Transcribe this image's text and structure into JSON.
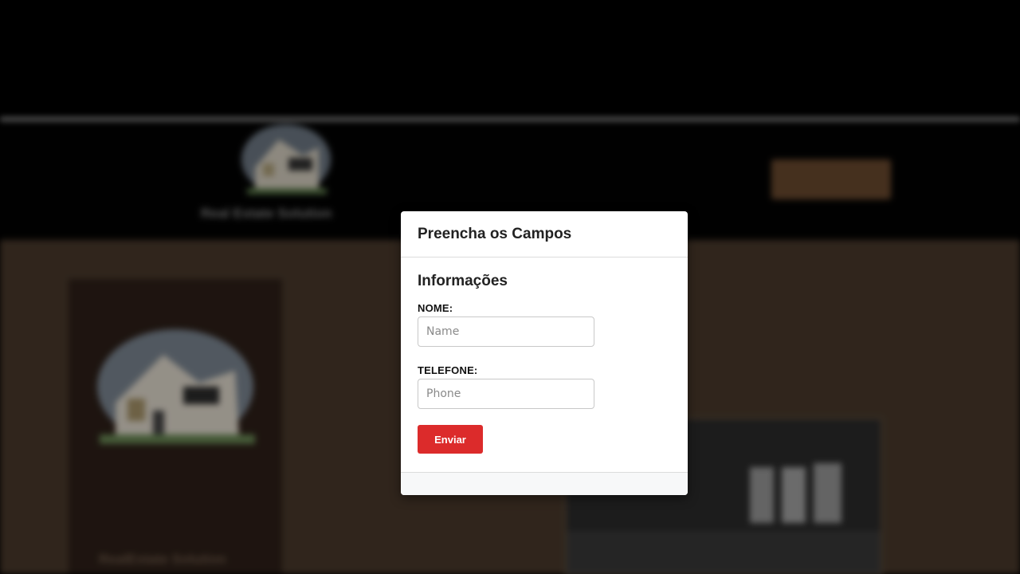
{
  "background": {
    "brand_text": "Real Estate Solution",
    "header_button_label": "",
    "card_text": "RealEstate Solution",
    "colors": {
      "header": "#030303",
      "content": "#4a3a2c",
      "card": "#2e2019",
      "accent_button": "#6b4a2f"
    }
  },
  "modal": {
    "title": "Preencha os Campos",
    "section_title": "Informações",
    "fields": [
      {
        "label": "NOME:",
        "placeholder": "Name",
        "value": ""
      },
      {
        "label": "TELEFONE:",
        "placeholder": "Phone",
        "value": ""
      }
    ],
    "submit_label": "Enviar",
    "colors": {
      "submit": "#dc2b2b",
      "footer": "#f7f8f9"
    }
  }
}
